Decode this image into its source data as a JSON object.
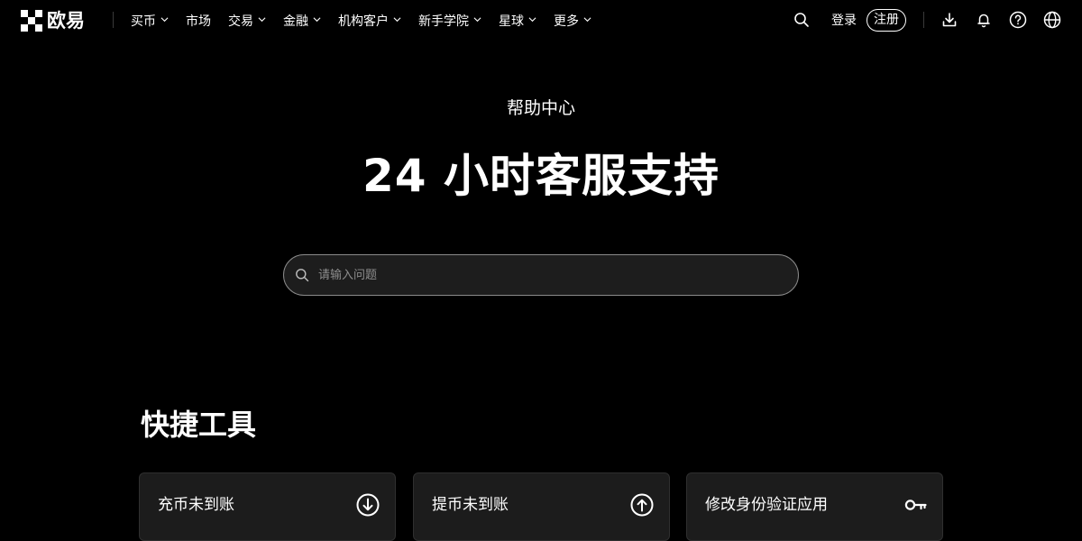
{
  "brand": {
    "name": "欧易"
  },
  "nav": {
    "menu": [
      {
        "label": "买币",
        "dropdown": true
      },
      {
        "label": "市场",
        "dropdown": false
      },
      {
        "label": "交易",
        "dropdown": true
      },
      {
        "label": "金融",
        "dropdown": true
      },
      {
        "label": "机构客户",
        "dropdown": true
      },
      {
        "label": "新手学院",
        "dropdown": true
      },
      {
        "label": "星球",
        "dropdown": true
      },
      {
        "label": "更多",
        "dropdown": true
      }
    ],
    "login_label": "登录",
    "signup_label": "注册",
    "icons": [
      "search-icon",
      "download-icon",
      "bell-icon",
      "help-icon",
      "globe-icon"
    ]
  },
  "hero": {
    "eyebrow": "帮助中心",
    "title": "24 小时客服支持",
    "search_placeholder": "请输入问题"
  },
  "quick_tools": {
    "title": "快捷工具",
    "items": [
      {
        "label": "充币未到账",
        "icon": "deposit-arrow-down-icon"
      },
      {
        "label": "提币未到账",
        "icon": "withdraw-arrow-up-icon"
      },
      {
        "label": "修改身份验证应用",
        "icon": "key-icon"
      }
    ]
  },
  "colors": {
    "background": "#000000",
    "text": "#ffffff",
    "search_bg": "#1d1d1d",
    "search_border": "#8a8a8a",
    "card_bg": "#1c1c1c",
    "placeholder": "#8e8e8e"
  }
}
